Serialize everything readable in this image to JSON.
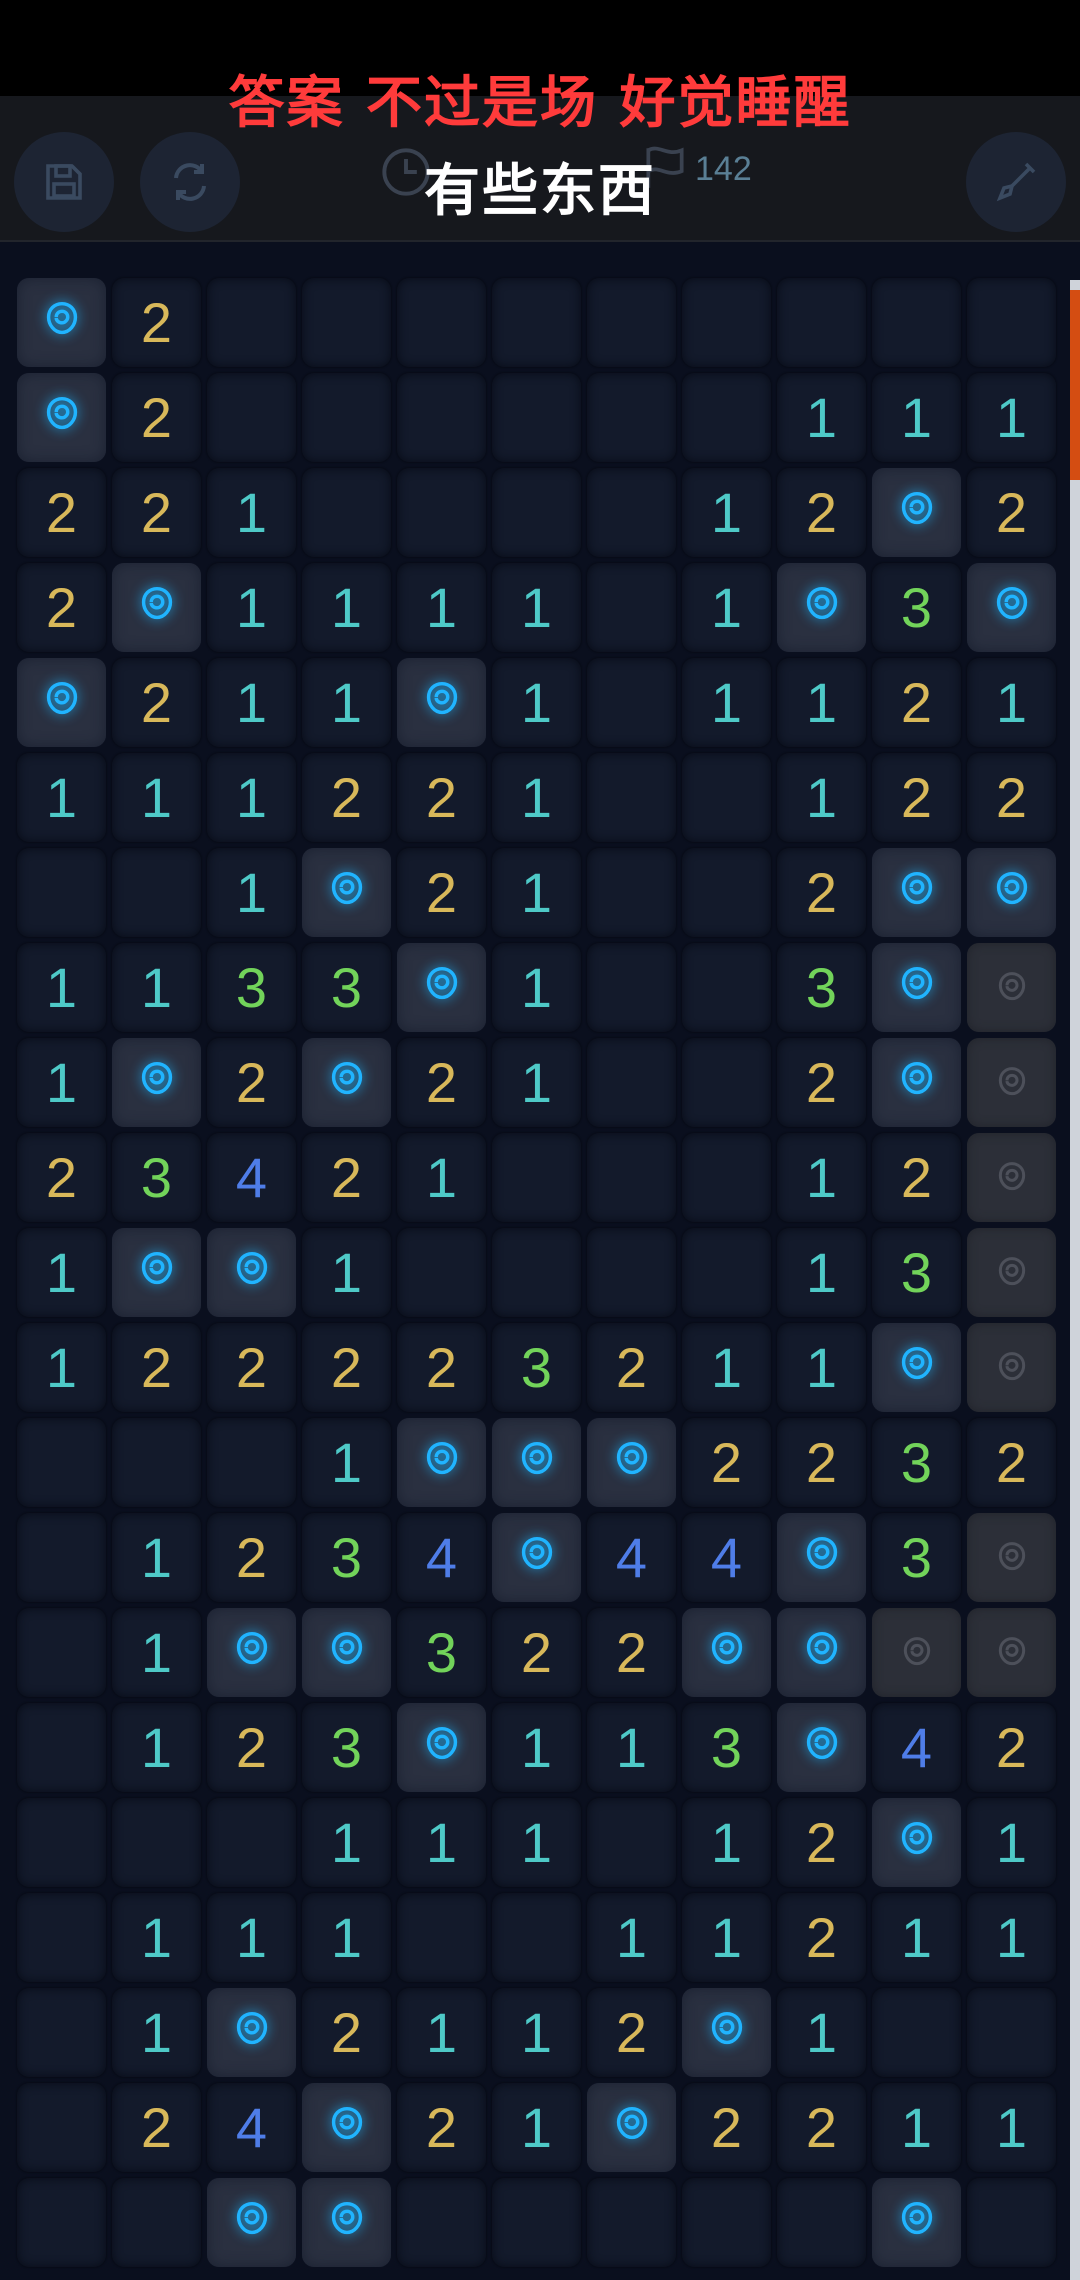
{
  "lyrics": {
    "line1": "答案 不过是场 好觉睡醒",
    "line2": "有些东西"
  },
  "toolbar": {
    "save_icon": "save-icon",
    "restart_icon": "restart-icon",
    "timer_icon": "clock-icon",
    "flag_icon": "flag-icon",
    "flag_count": "142",
    "shovel_icon": "shovel-icon"
  },
  "colors": {
    "one": "#4ec9c7",
    "two": "#d8b85a",
    "three": "#72d35a",
    "four": "#4f7de8",
    "rose": "#20b4ff",
    "lyric_red": "#ff3b3b"
  },
  "board": {
    "columns": 11,
    "rows": [
      [
        "R",
        "2",
        "",
        "",
        "",
        "",
        "",
        "",
        "",
        "",
        ""
      ],
      [
        "R",
        "2",
        "",
        "",
        "",
        "",
        "",
        "",
        "1",
        "1",
        "1"
      ],
      [
        "2",
        "2",
        "1",
        "",
        "",
        "",
        "",
        "1",
        "2",
        "R",
        "2"
      ],
      [
        "2",
        "R",
        "1",
        "1",
        "1",
        "1",
        "",
        "1",
        "R",
        "3",
        "R"
      ],
      [
        "R",
        "2",
        "1",
        "1",
        "R",
        "1",
        "",
        "1",
        "1",
        "2",
        "1"
      ],
      [
        "1",
        "1",
        "1",
        "2",
        "2",
        "1",
        "",
        "",
        "1",
        "2",
        "2"
      ],
      [
        "",
        "",
        "1",
        "R",
        "2",
        "1",
        "",
        "",
        "2",
        "R",
        "R"
      ],
      [
        "1",
        "1",
        "3",
        "3",
        "R",
        "1",
        "",
        "",
        "3",
        "R",
        "H"
      ],
      [
        "1",
        "R",
        "2",
        "R",
        "2",
        "1",
        "",
        "",
        "2",
        "R",
        "H"
      ],
      [
        "2",
        "3",
        "4",
        "2",
        "1",
        "",
        "",
        "",
        "1",
        "2",
        "H"
      ],
      [
        "1",
        "R",
        "R",
        "1",
        "",
        "",
        "",
        "",
        "1",
        "3",
        "H"
      ],
      [
        "1",
        "2",
        "2",
        "2",
        "2",
        "3",
        "2",
        "1",
        "1",
        "R",
        "H"
      ],
      [
        "",
        "",
        "",
        "1",
        "R",
        "R",
        "R",
        "2",
        "2",
        "3",
        "2"
      ],
      [
        "",
        "1",
        "2",
        "3",
        "4",
        "R",
        "4",
        "4",
        "R",
        "3",
        "H"
      ],
      [
        "",
        "1",
        "R",
        "R",
        "3",
        "2",
        "2",
        "R",
        "R",
        "H",
        "H"
      ],
      [
        "",
        "1",
        "2",
        "3",
        "R",
        "1",
        "1",
        "3",
        "R",
        "4",
        "2"
      ],
      [
        "",
        "",
        "",
        "1",
        "1",
        "1",
        "",
        "1",
        "2",
        "R",
        "1"
      ],
      [
        "",
        "1",
        "1",
        "1",
        "",
        "",
        "1",
        "1",
        "2",
        "1",
        "1"
      ],
      [
        "",
        "1",
        "R",
        "2",
        "1",
        "1",
        "2",
        "R",
        "1",
        "",
        ""
      ],
      [
        "",
        "2",
        "4",
        "R",
        "2",
        "1",
        "R",
        "2",
        "2",
        "1",
        "1"
      ],
      [
        "",
        "",
        "R",
        "R",
        "",
        "",
        "",
        "",
        "",
        "R",
        ""
      ]
    ]
  }
}
